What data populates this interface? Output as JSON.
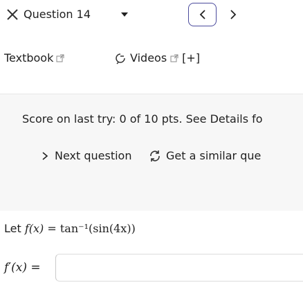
{
  "header": {
    "question_title": "Question 14",
    "prev_label": "<",
    "next_label": ">"
  },
  "resources": {
    "textbook_label": "Textbook",
    "videos_label": "Videos",
    "videos_more": "[+]"
  },
  "score_panel": {
    "score_text": "Score on last try: 0 of 10 pts. See Details fo",
    "next_question_label": "Next question",
    "similar_question_label": "Get a similar que"
  },
  "problem": {
    "intro": "Let ",
    "lhs": "f(x)",
    "rhs": "= tan⁻¹(sin(4x))",
    "answer_label": "f′(x) ="
  },
  "answer": {
    "value": "",
    "placeholder": ""
  },
  "colors": {
    "accent": "#4a4a9c",
    "panel_bg": "#f7f7f7"
  },
  "icons": [
    "close-icon",
    "chevron-down-icon",
    "chevron-left-icon",
    "chevron-right-icon",
    "external-link-icon",
    "video-icon",
    "refresh-icon"
  ]
}
